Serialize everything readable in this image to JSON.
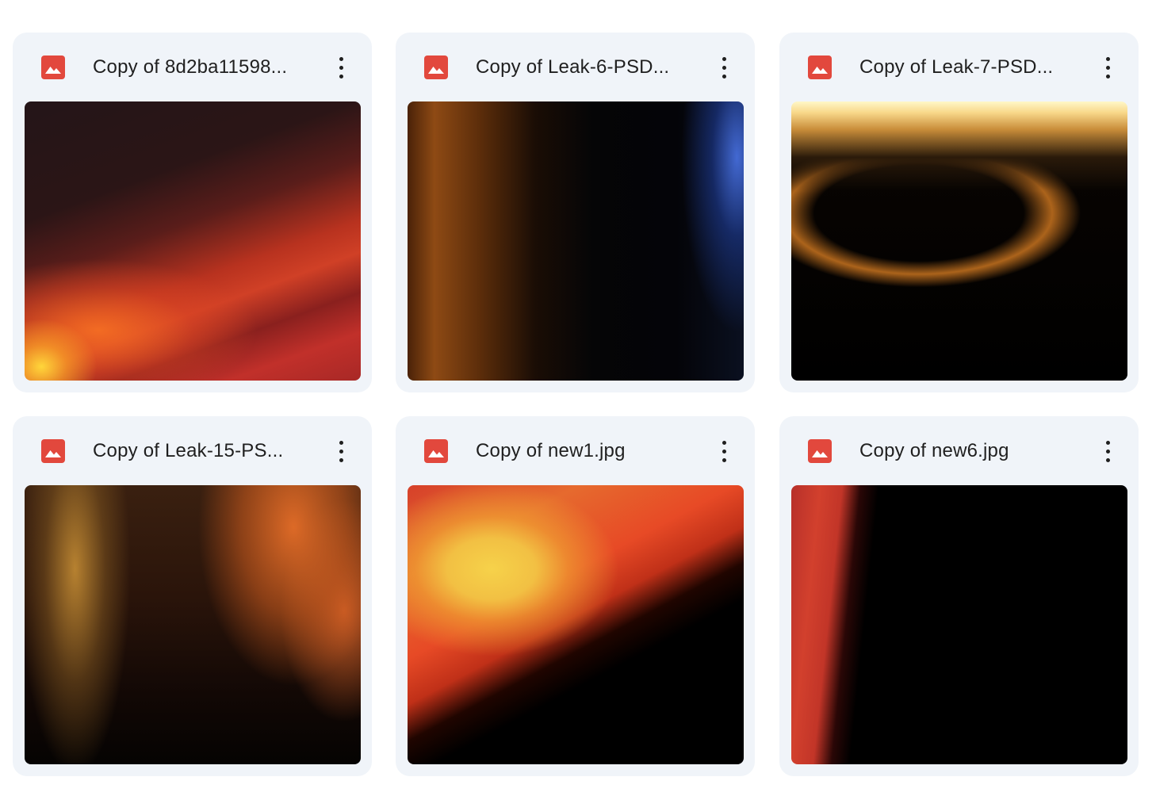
{
  "files": [
    {
      "name": "Copy of 8d2ba11598...",
      "type_icon": "image-icon",
      "more_icon": "more-vert-icon"
    },
    {
      "name": "Copy of Leak-6-PSD...",
      "type_icon": "image-icon",
      "more_icon": "more-vert-icon"
    },
    {
      "name": "Copy of Leak-7-PSD...",
      "type_icon": "image-icon",
      "more_icon": "more-vert-icon"
    },
    {
      "name": "Copy of Leak-15-PS...",
      "type_icon": "image-icon",
      "more_icon": "more-vert-icon"
    },
    {
      "name": "Copy of new1.jpg",
      "type_icon": "image-icon",
      "more_icon": "more-vert-icon"
    },
    {
      "name": "Copy of new6.jpg",
      "type_icon": "image-icon",
      "more_icon": "more-vert-icon"
    }
  ],
  "colors": {
    "card_background": "#f0f4f9",
    "image_icon": "#e2483d",
    "text": "#1f1f1f"
  }
}
